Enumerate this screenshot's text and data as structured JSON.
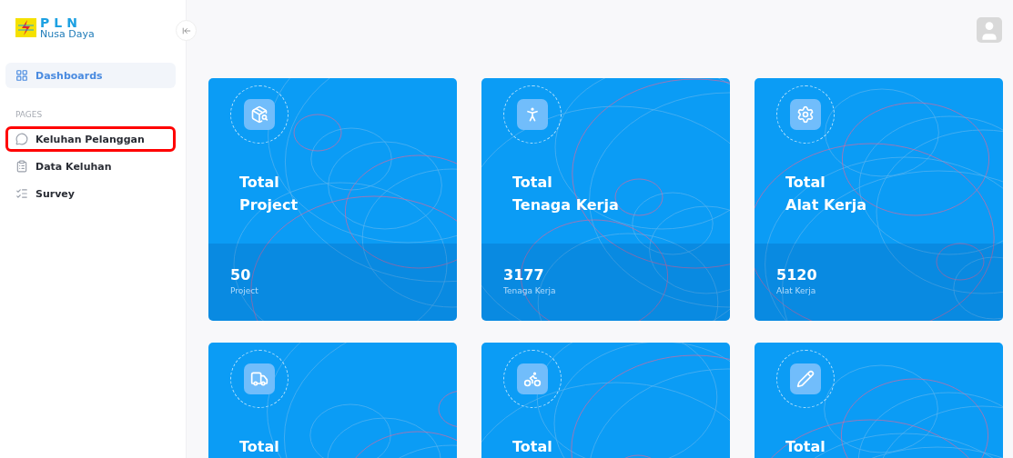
{
  "sidebar": {
    "logo": {
      "brand": "PLN",
      "subtitle": "Nusa Daya"
    },
    "top_items": [
      {
        "label": "Dashboards",
        "selected": true,
        "marked": false
      }
    ],
    "section_label": "PAGES",
    "items": [
      {
        "label": "Keluhan Pelanggan",
        "selected": false,
        "marked": true
      },
      {
        "label": "Data Keluhan",
        "selected": false,
        "marked": false
      },
      {
        "label": "Survey",
        "selected": false,
        "marked": false
      }
    ]
  },
  "cards": [
    {
      "title": [
        "Total",
        "Project"
      ],
      "value": "50",
      "unit": "Project"
    },
    {
      "title": [
        "Total",
        "Tenaga Kerja"
      ],
      "value": "3177",
      "unit": "Tenaga Kerja"
    },
    {
      "title": [
        "Total",
        "Alat Kerja"
      ],
      "value": "5120",
      "unit": "Alat Kerja"
    },
    {
      "title": [
        "Total"
      ]
    },
    {
      "title": [
        "Total"
      ]
    },
    {
      "title": [
        "Total"
      ]
    }
  ]
}
